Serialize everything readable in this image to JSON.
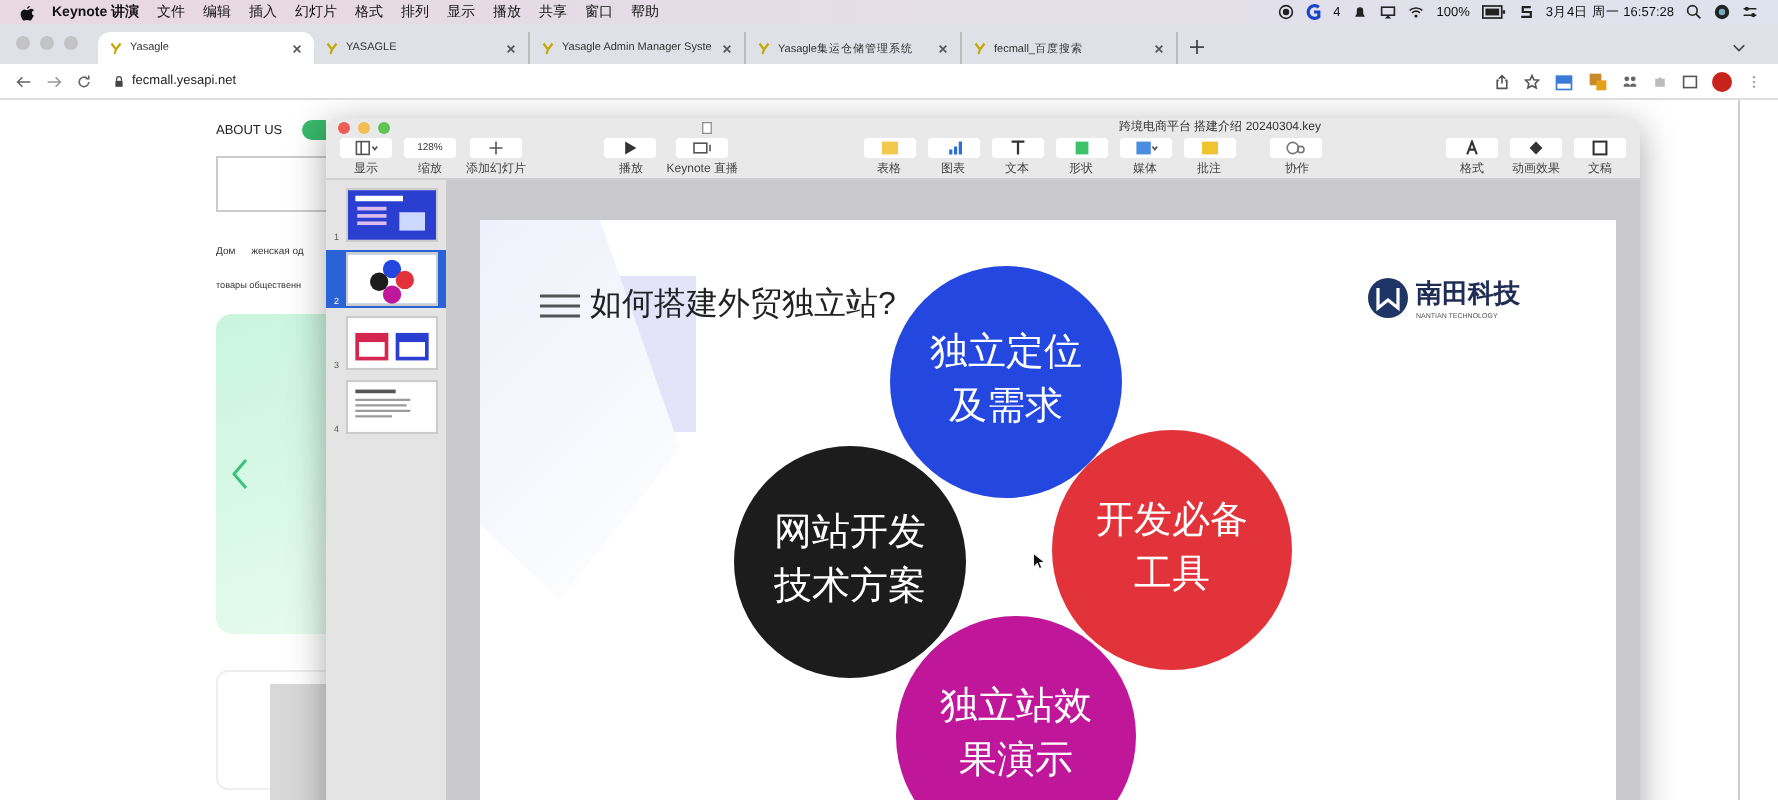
{
  "menu_bar": {
    "app": "Keynote 讲演",
    "items": [
      "文件",
      "编辑",
      "插入",
      "幻灯片",
      "格式",
      "排列",
      "显示",
      "播放",
      "共享",
      "窗口",
      "帮助"
    ],
    "badge": "4",
    "battery": "100%",
    "clock": "3月4日 周一 16:57:28"
  },
  "browser": {
    "tabs": [
      {
        "label": "Yasagle",
        "selected": true
      },
      {
        "label": "YASAGLE",
        "selected": false
      },
      {
        "label": "Yasagle Admin Manager Syste",
        "selected": false
      },
      {
        "label": "Yasagle集运仓储管理系统",
        "selected": false
      },
      {
        "label": "fecmall_百度搜索",
        "selected": false
      }
    ],
    "url": "fecmall.yesapi.net"
  },
  "web_page": {
    "nav_link": "ABOUT US",
    "categories": [
      "Дом",
      "женская од"
    ],
    "category_2": "товары общественн"
  },
  "keynote": {
    "title": "跨境电商平台 搭建介绍 20240304.key",
    "toolbar": {
      "view_group": [
        {
          "kind": "view",
          "label": "显示"
        },
        {
          "kind": "zoom",
          "label": "缩放",
          "value": "128%"
        },
        {
          "kind": "add",
          "label": "添加幻灯片"
        }
      ],
      "play_group": [
        {
          "kind": "play",
          "label": "播放"
        },
        {
          "kind": "live",
          "label": "Keynote 直播"
        }
      ],
      "insert_group": [
        {
          "kind": "table",
          "label": "表格"
        },
        {
          "kind": "chart",
          "label": "图表"
        },
        {
          "kind": "text",
          "label": "文本"
        },
        {
          "kind": "shape",
          "label": "形状"
        },
        {
          "kind": "media",
          "label": "媒体"
        },
        {
          "kind": "comment",
          "label": "批注"
        }
      ],
      "collab_group": [
        {
          "kind": "collab",
          "label": "协作"
        }
      ],
      "format_group": [
        {
          "kind": "format",
          "label": "格式"
        },
        {
          "kind": "animate",
          "label": "动画效果"
        },
        {
          "kind": "document",
          "label": "文稿"
        }
      ]
    },
    "slides": [
      {
        "number": "1",
        "kind": "title",
        "selected": false
      },
      {
        "number": "2",
        "kind": "circles",
        "selected": true
      },
      {
        "number": "3",
        "kind": "cards",
        "selected": false
      },
      {
        "number": "4",
        "kind": "text",
        "selected": false
      }
    ],
    "slide": {
      "title": "如何搭建外贸独立站?",
      "logo_name": "南田科技",
      "logo_sub": "NANTIAN TECHNOLOGY",
      "circles": [
        {
          "label": "独立定位及需求",
          "color": "#2447e0"
        },
        {
          "label": "网站开发技术方案",
          "color": "#1c1c1c"
        },
        {
          "label": "开发必备工具",
          "color": "#e2333a"
        },
        {
          "label": "独立站效果演示",
          "color": "#c0169a"
        }
      ]
    }
  }
}
